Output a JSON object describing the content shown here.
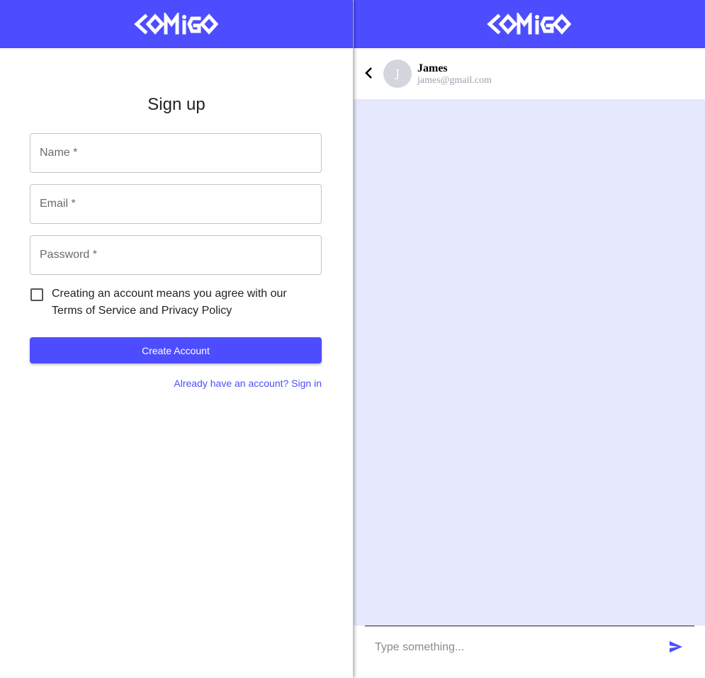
{
  "brand": {
    "logo_text": "COMIGO",
    "color": "#4d4dff"
  },
  "signup": {
    "title": "Sign up",
    "fields": {
      "name_label": "Name *",
      "email_label": "Email *",
      "password_label": "Password *",
      "name_value": "",
      "email_value": "",
      "password_value": ""
    },
    "agree_checked": false,
    "agree_line1": "Creating an account means you agree with our",
    "agree_line2": "Terms of Service and Privacy Policy",
    "create_button": "Create Account",
    "signin_link": "Already have an account? Sign in"
  },
  "chat": {
    "contact": {
      "avatar_letter": "J",
      "name": "James",
      "email": "james@gmail.com"
    },
    "messages": [],
    "composer_placeholder": "Type something...",
    "icons": {
      "back": "chevron-left-icon",
      "send": "send-icon"
    },
    "background_color": "#e6e9fd"
  }
}
